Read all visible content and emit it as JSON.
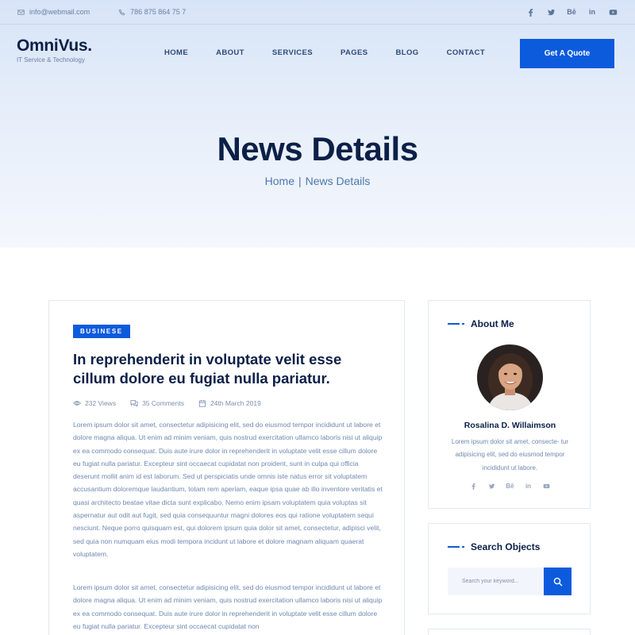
{
  "topbar": {
    "email": "info@webmail.com",
    "phone": "786 875 864 75 7",
    "socials": [
      "facebook-icon",
      "twitter-icon",
      "behance-icon",
      "linkedin-icon",
      "youtube-icon"
    ]
  },
  "header": {
    "logo_name": "OmniVus.",
    "logo_tagline": "IT Service & Technology",
    "nav": [
      "HOME",
      "ABOUT",
      "SERVICES",
      "PAGES",
      "BLOG",
      "CONTACT"
    ],
    "cta_label": "Get A Quote"
  },
  "hero": {
    "title": "News Details",
    "breadcrumb_home": "Home",
    "breadcrumb_sep": "|",
    "breadcrumb_current": "News Details"
  },
  "post": {
    "category": "BUSINESE",
    "title": "In reprehenderit in voluptate velit esse cillum dolore eu fugiat nulla pariatur.",
    "views": "232 Views",
    "comments": "35 Comments",
    "date": "24th March 2019",
    "paragraph1": "Lorem ipsum dolor sit amet, consectetur adipisicing elit, sed do eiusmod tempor incididunt ut labore et dolore magna aliqua. Ut enim ad minim veniam, quis nostrud exercitation ullamco laboris nisi ut aliquip ex ea commodo consequat. Duis aute irure dolor in reprehenderit in voluptate velit esse cillum dolore eu fugiat nulla pariatur. Excepteur sint occaecat cupidatat non proident, sunt in culpa qui officia deserunt mollit anim id est laborum. Sed ut perspiciatis unde omnis iste natus error sit voluptatem accusantium doloremque laudantium, totam rem aperiam, eaque ipsa quae ab illo inventore veritatis et quasi architecto beatae vitae dicta sunt explicabo. Nemo enim ipsam voluptatem quia voluptas sit aspernatur aut odit aut fugit, sed quia consequuntur magni dolores eos qui ratione voluptatem sequi nesciunt. Neque porro quisquam est, qui dolorem ipsum quia dolor sit amet, consectetur, adipisci velit, sed quia non numquam eius modi tempora incidunt ut labore et dolore magnam aliquam quaerat voluptatem.",
    "paragraph2": "Lorem ipsum dolor sit amet, consectetur adipisicing elit, sed do eiusmod tempor incididunt ut labore et dolore magna aliqua. Ut enim ad minim veniam, quis nostrud exercitation ullamco laboris nisi ut aliquip ex ea commodo consequat. Duis aute irure dolor in reprehenderit in voluptate velit esse cillum dolore eu fugiat nulla pariatur. Excepteur sint occaecat cupidatat non"
  },
  "sidebar": {
    "about": {
      "title": "About Me",
      "name": "Rosalina D. Willaimson",
      "bio": "Lorem ipsum dolor sit amet, consecte- tur adipisicing elit, sed do eiusmod tempor incididunt ut labore.",
      "socials": [
        "facebook-icon",
        "twitter-icon",
        "behance-icon",
        "linkedin-icon",
        "youtube-icon"
      ]
    },
    "search": {
      "title": "Search Objects",
      "placeholder": "Search your keyword..."
    }
  },
  "colors": {
    "accent": "#0d5bdd",
    "heading": "#0b2048",
    "body_text": "#6f88b0",
    "hero_bg": "#dde7f7"
  }
}
